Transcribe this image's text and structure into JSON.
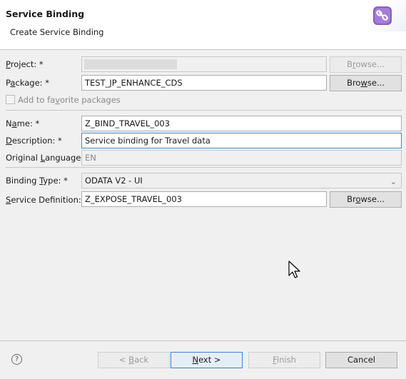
{
  "header": {
    "title": "Service Binding",
    "subtitle": "Create Service Binding"
  },
  "form": {
    "project": {
      "label": "Project: *",
      "value": "",
      "browse": "Browse..."
    },
    "package": {
      "label": "Package: *",
      "value": "TEST_JP_ENHANCE_CDS",
      "browse": "Browse..."
    },
    "favorite": {
      "label": "Add to favorite packages",
      "checked": false
    },
    "name": {
      "label": "Name: *",
      "value": "Z_BIND_TRAVEL_003"
    },
    "description": {
      "label": "Description: *",
      "value": "Service binding for Travel data"
    },
    "original_language": {
      "label": "Original Language:",
      "value": "EN"
    },
    "binding_type": {
      "label": "Binding Type: *",
      "value": "ODATA V2 - UI"
    },
    "service_definition": {
      "label": "Service Definition: *",
      "value": "Z_EXPOSE_TRAVEL_003",
      "browse": "Browse..."
    }
  },
  "footer": {
    "back": "< Back",
    "next": "Next >",
    "finish": "Finish",
    "cancel": "Cancel"
  },
  "icons": {
    "header": "service-binding-icon",
    "help": "help-icon",
    "dropdown": "chevron-down-icon",
    "cursor": "mouse-cursor"
  },
  "colors": {
    "accent": "#3c8dd8",
    "header_icon": "#8b5fbf"
  }
}
